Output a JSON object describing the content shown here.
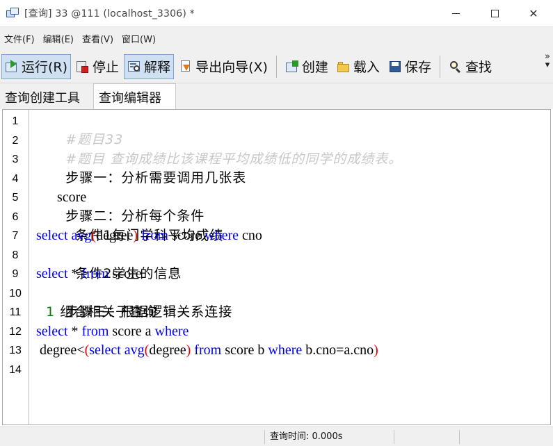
{
  "window": {
    "title": "[查询] 33 @111 (localhost_3306) *",
    "controls": [
      "–",
      "☐",
      "✕"
    ]
  },
  "menu": [
    {
      "label": "文件(F)"
    },
    {
      "label": "编辑(E)"
    },
    {
      "label": "查看(V)"
    },
    {
      "label": "窗口(W)"
    }
  ],
  "toolbar": {
    "run": "运行(R)",
    "stop": "停止",
    "explain": "解释",
    "export": "导出向导(X)",
    "create": "创建",
    "load": "载入",
    "save": "保存",
    "find": "查找",
    "more": "»"
  },
  "tabs": {
    "builder": "查询创建工具",
    "editor": "查询编辑器"
  },
  "editor": {
    "line_numbers": [
      "1",
      "2",
      "3",
      "4",
      "5",
      "6",
      "7",
      "8",
      "9",
      "10",
      "11",
      "12",
      "13",
      "14"
    ],
    "lines": {
      "l1": "#题目33",
      "l2": "#题目 查询成绩比该课程平均成绩低的同学的成绩表。",
      "l3": "步骤一：分析需要调用几张表",
      "l4": "score",
      "l5": "步骤二：分析每个条件",
      "l6": "  条件1每门学科平均成绩",
      "l7": {
        "kw1": "select",
        "kw2": "avg",
        "p1": "(",
        "t1": "degree",
        "p2": ")",
        "kw3": " from ",
        "t2": "score ",
        "kw4": "where",
        "t3": " cno"
      },
      "l8": "  条件2学生的信息",
      "l9": {
        "kw1": "select",
        "t1": " * ",
        "kw2": "from",
        "t2": " score"
      },
      "l10": "步骤三：根据逻辑关系连接",
      "l11": {
        "n1": "  1",
        "t1": " 组合相关子查询"
      },
      "l12": {
        "kw1": "select",
        "t1": " * ",
        "kw2": "from",
        "t2": " score a ",
        "kw3": "where"
      },
      "l13": {
        "t1": " degree<",
        "p1": "(",
        "kw1": "select avg",
        "p2": "(",
        "t2": "degree",
        "p3": ")",
        "kw2": " from ",
        "t3": "score b ",
        "kw3": "where",
        "t4": " b.cno=a.cno",
        "p4": ")"
      }
    }
  },
  "status": {
    "query_time": "查询时间: 0.000s"
  }
}
